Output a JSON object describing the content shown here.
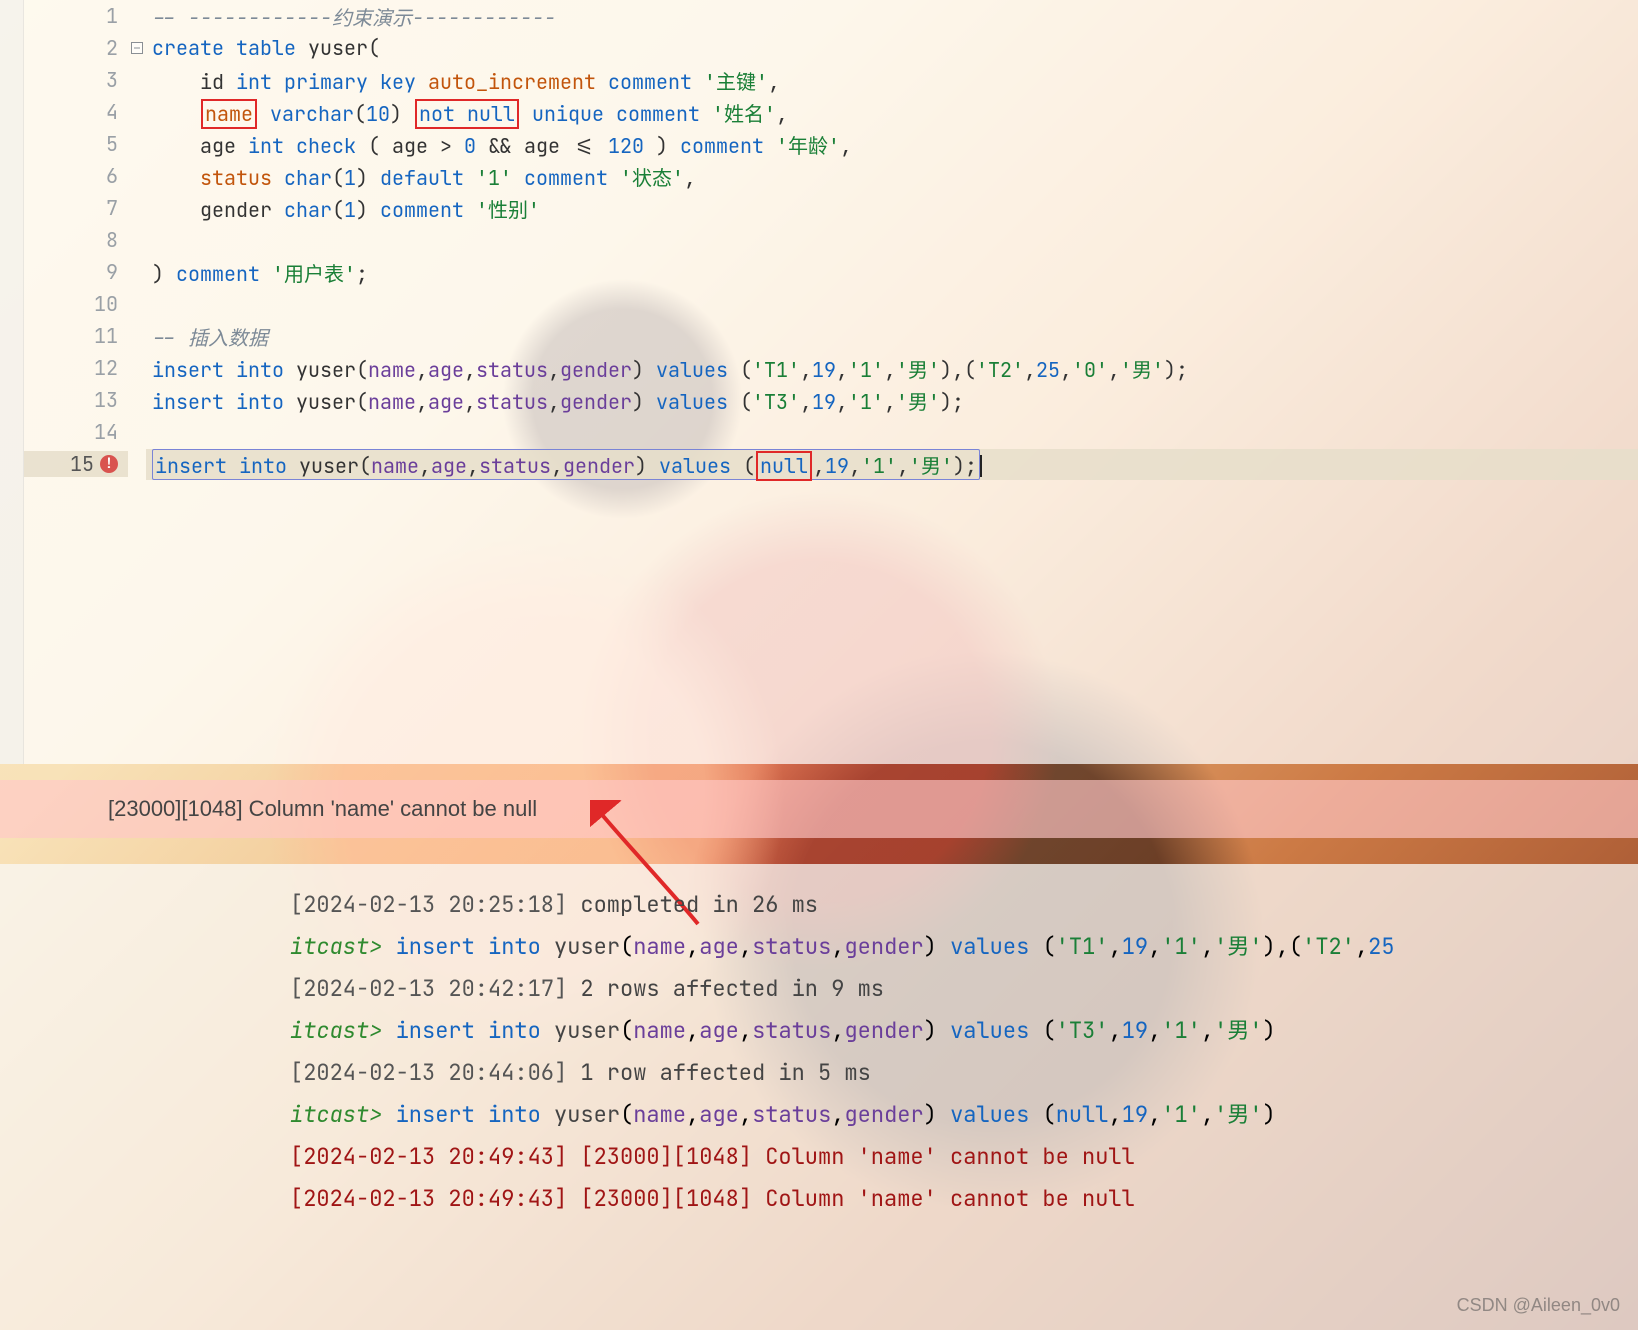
{
  "editor": {
    "lines": [
      1,
      2,
      3,
      4,
      5,
      6,
      7,
      8,
      9,
      10,
      11,
      12,
      13,
      14,
      15
    ],
    "fold_on_line": 2,
    "error_on_line": 15,
    "code": {
      "c1_comment_left": "-- ------------",
      "c1_comment_mid": "约束演示",
      "c1_comment_right": "------------",
      "c2_create": "create table",
      "c2_tbl": "yuser",
      "c2_paren": "(",
      "c3_id": "id",
      "c3_type": "int",
      "c3_pk": "primary key",
      "c3_auto": "auto_increment",
      "c3_comment_kw": "comment",
      "c3_comment_str": "'主键'",
      "c4_name": "name",
      "c4_type": "varchar",
      "c4_len": "10",
      "c4_notnull": "not null",
      "c4_unique": "unique",
      "c4_comment_kw": "comment",
      "c4_comment_str": "'姓名'",
      "c5_age": "age",
      "c5_type": "int",
      "c5_check": "check",
      "c5_expr_age1": "age",
      "c5_gt": ">",
      "c5_zero": "0",
      "c5_and": "&&",
      "c5_expr_age2": "age",
      "c5_le": "<=",
      "c5_120": "120",
      "c5_comment_kw": "comment",
      "c5_comment_str": "'年龄'",
      "c6_status": "status",
      "c6_type": "char",
      "c6_len": "1",
      "c6_default": "default",
      "c6_defval": "'1'",
      "c6_comment_kw": "comment",
      "c6_comment_str": "'状态'",
      "c7_gender": "gender",
      "c7_type": "char",
      "c7_len": "1",
      "c7_comment_kw": "comment",
      "c7_comment_str": "'性别'",
      "c9_close": ")",
      "c9_comment_kw": "comment",
      "c9_comment_str": "'用户表'",
      "c11_comment": "-- 插入数据",
      "ins_kw": "insert into",
      "ins_tbl": "yuser",
      "ins_cols_name": "name",
      "ins_cols_age": "age",
      "ins_cols_status": "status",
      "ins_cols_gender": "gender",
      "ins_values_kw": "values",
      "i12_v_t1": "'T1'",
      "i12_v_19": "19",
      "i12_v_s1": "'1'",
      "i12_v_m": "'男'",
      "i12_v_t2": "'T2'",
      "i12_v_25": "25",
      "i12_v_s0": "'0'",
      "i13_v_t3": "'T3'",
      "i15_v_null": "null",
      "semicolon": ";",
      "comma": ","
    }
  },
  "error_bar": {
    "message": "[23000][1048] Column 'name' cannot be null"
  },
  "console": {
    "l1_ts": "[2024-02-13 20:25:18]",
    "l1_msg": "completed in 26 ms",
    "l2_prompt": "itcast>",
    "l2_stmt_tail_values": "('T1',19,'1','男'),('T2',25",
    "l3_ts": "[2024-02-13 20:42:17]",
    "l3_msg": "2 rows affected in 9 ms",
    "l4_stmt_tail_values": "('T3',19,'1','男')",
    "l5_ts": "[2024-02-13 20:44:06]",
    "l5_msg": "1 row affected in 5 ms",
    "l6_stmt_tail_values": "(null,19,'1','男')",
    "l7_ts": "[2024-02-13 20:49:43]",
    "l7_msg": "[23000][1048] Column 'name' cannot be null",
    "l8_ts": "[2024-02-13 20:49:43]",
    "l8_msg": "[23000][1048] Column 'name' cannot be null",
    "insert_kw": "insert into",
    "tbl": "yuser",
    "cols_name": "name",
    "cols_age": "age",
    "cols_status": "status",
    "cols_gender": "gender",
    "values_kw": "values"
  },
  "watermark": "CSDN @Aileen_0v0"
}
